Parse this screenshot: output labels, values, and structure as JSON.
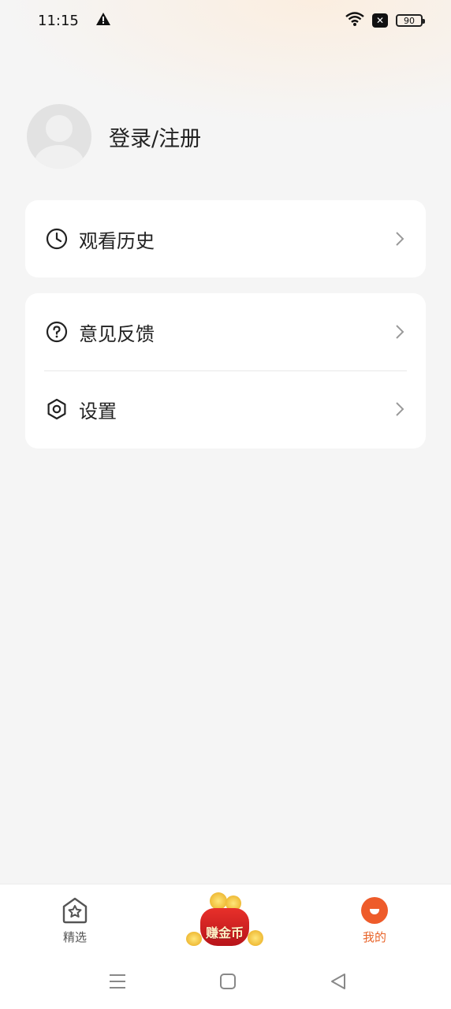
{
  "status_bar": {
    "time": "11:15",
    "battery": "90",
    "icons": [
      "warning-icon",
      "wifi-icon",
      "no-sim-icon",
      "battery-icon"
    ]
  },
  "profile": {
    "login_label": "登录/注册"
  },
  "menu": {
    "history_label": "观看历史",
    "feedback_label": "意见反馈",
    "settings_label": "设置"
  },
  "tabbar": {
    "home_label": "精选",
    "coin_label": "赚金币",
    "me_label": "我的",
    "active_color": "#e8642a"
  },
  "colors": {
    "background": "#f5f5f5",
    "card": "#ffffff",
    "accent": "#ee5b2a"
  }
}
